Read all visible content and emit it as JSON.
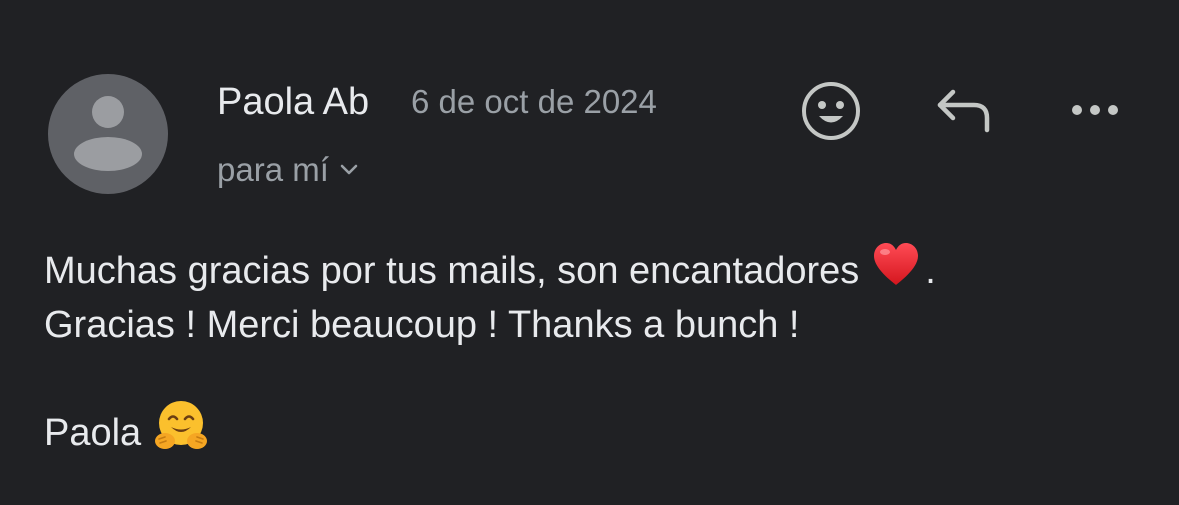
{
  "email": {
    "sender_name": "Paola Ab",
    "date": "6 de oct de 2024",
    "recipient_label": "para mí",
    "body": {
      "line1_text": "Muchas gracias por tus mails, son encantadores",
      "line1_end": ".",
      "line2_text": "Gracias ! Merci beaucoup ! Thanks a bunch !",
      "signature": "Paola"
    }
  },
  "icons": {
    "avatar": "person-avatar-icon",
    "recipient_toggle": "chevron-down-icon",
    "add_reaction": "smiley-icon",
    "reply": "reply-arrow-icon",
    "more": "more-horizontal-icon",
    "heart": "red-heart-emoji",
    "hug": "hugging-face-emoji"
  },
  "colors": {
    "background": "#202124",
    "avatar_bg": "#5f6166",
    "primary_text": "#e8eaed",
    "secondary_text": "#9aa0a6",
    "icon": "#c4c7c5",
    "heart": "#e8262f",
    "hug_face": "#fbc02d"
  }
}
